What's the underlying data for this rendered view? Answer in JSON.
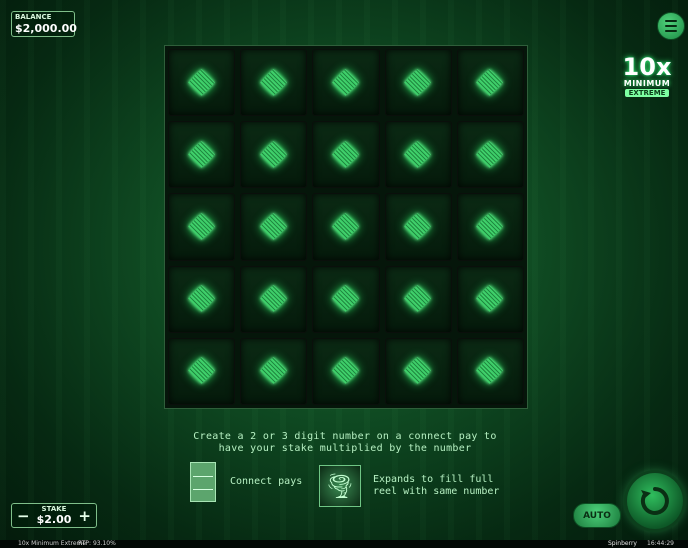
{
  "balance": {
    "label": "BALANCE",
    "value": "$2,000.00"
  },
  "logo": {
    "big": "10x",
    "mid": "MINIMUM",
    "small": "EXTREME"
  },
  "grid": {
    "rows": 5,
    "cols": 5,
    "symbol": "green-diamond"
  },
  "info": {
    "line1": "Create a 2 or 3 digit number on a connect pay to",
    "line2": "have your stake multiplied by the number",
    "connect_label": "Connect pays",
    "expand_line1": "Expands to fill full",
    "expand_line2": "reel with same number"
  },
  "stake": {
    "label": "STAKE",
    "value": "$2.00",
    "minus": "−",
    "plus": "+"
  },
  "auto_label": "AUTO",
  "footer": {
    "game": "10x Minimum Extreme",
    "rtp": "RTP: 93.10%",
    "brand": "Spinberry",
    "time": "16:44:29"
  },
  "colors": {
    "accent": "#2eff6e",
    "panel": "#05160a"
  }
}
